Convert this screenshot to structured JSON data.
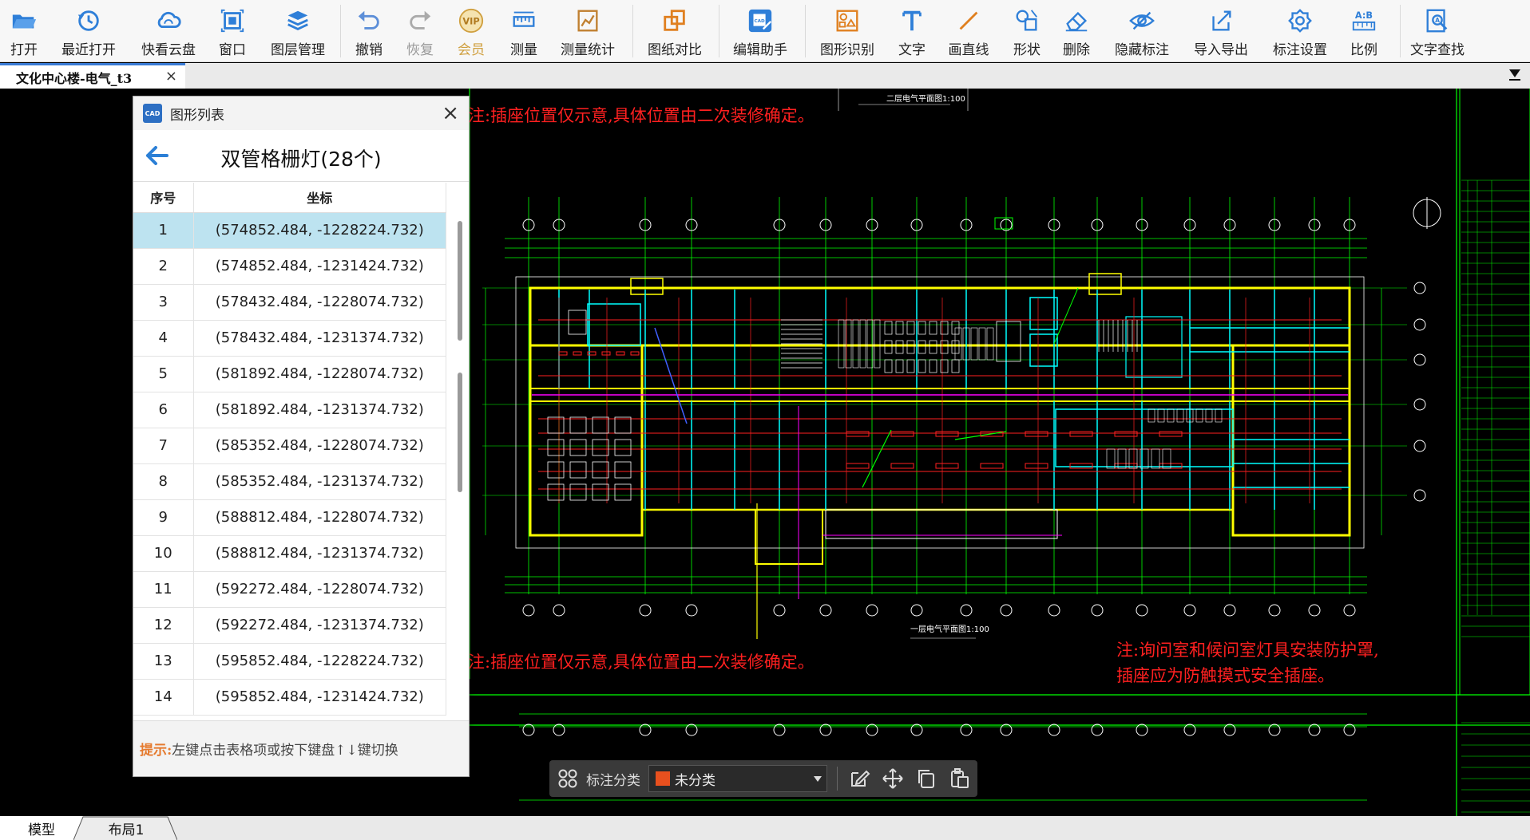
{
  "toolbar": {
    "items": [
      {
        "label": "打开",
        "icon": "folder-open-icon"
      },
      {
        "label": "最近打开",
        "icon": "history-icon"
      },
      {
        "label": "快看云盘",
        "icon": "cloud-icon"
      },
      {
        "label": "窗口",
        "icon": "window-icon"
      },
      {
        "label": "图层管理",
        "icon": "layers-icon"
      },
      {
        "label": "撤销",
        "icon": "undo-icon"
      },
      {
        "label": "恢复",
        "icon": "redo-icon"
      },
      {
        "label": "会员",
        "icon": "vip-icon"
      },
      {
        "label": "测量",
        "icon": "ruler-icon"
      },
      {
        "label": "测量统计",
        "icon": "measure-stats-icon"
      },
      {
        "label": "图纸对比",
        "icon": "compare-icon"
      },
      {
        "label": "编辑助手",
        "icon": "cad-edit-icon"
      },
      {
        "label": "图形识别",
        "icon": "shape-recognize-icon"
      },
      {
        "label": "文字",
        "icon": "text-icon"
      },
      {
        "label": "画直线",
        "icon": "line-icon"
      },
      {
        "label": "形状",
        "icon": "shapes-icon"
      },
      {
        "label": "删除",
        "icon": "eraser-icon"
      },
      {
        "label": "隐藏标注",
        "icon": "eye-hide-icon"
      },
      {
        "label": "导入导出",
        "icon": "import-export-icon"
      },
      {
        "label": "标注设置",
        "icon": "annotation-settings-icon"
      },
      {
        "label": "比例",
        "icon": "scale-icon"
      },
      {
        "label": "文字查找",
        "icon": "text-search-icon"
      }
    ],
    "vip_icon_text": "VIP",
    "scale_icon_text": "A:B",
    "cad_icon_text": "CAD"
  },
  "tab": {
    "title": "文化中心楼-电气_t3",
    "close": "×"
  },
  "panel": {
    "title": "图形列表",
    "logo_text": "CAD",
    "close": "×",
    "group_title": "双管格栅灯(28个)",
    "columns": [
      "序号",
      "坐标"
    ],
    "selected_index": 0,
    "rows": [
      {
        "index": "1",
        "coord": "(574852.484, -1228224.732)"
      },
      {
        "index": "2",
        "coord": "(574852.484, -1231424.732)"
      },
      {
        "index": "3",
        "coord": "(578432.484, -1228074.732)"
      },
      {
        "index": "4",
        "coord": "(578432.484, -1231374.732)"
      },
      {
        "index": "5",
        "coord": "(581892.484, -1228074.732)"
      },
      {
        "index": "6",
        "coord": "(581892.484, -1231374.732)"
      },
      {
        "index": "7",
        "coord": "(585352.484, -1228074.732)"
      },
      {
        "index": "8",
        "coord": "(585352.484, -1231374.732)"
      },
      {
        "index": "9",
        "coord": "(588812.484, -1228074.732)"
      },
      {
        "index": "10",
        "coord": "(588812.484, -1231374.732)"
      },
      {
        "index": "11",
        "coord": "(592272.484, -1228074.732)"
      },
      {
        "index": "12",
        "coord": "(592272.484, -1231374.732)"
      },
      {
        "index": "13",
        "coord": "(595852.484, -1228224.732)"
      },
      {
        "index": "14",
        "coord": "(595852.484, -1231424.732)"
      }
    ],
    "hint_label": "提示:",
    "hint_text": "左键点击表格项或按下键盘↑↓键切换"
  },
  "drawing": {
    "note_top": "注:插座位置仅示意,具体位置由二次装修确定。",
    "note_bottom": "注:插座位置仅示意,具体位置由二次装修确定。",
    "note_right_1": "注:询问室和候问室灯具安装防护罩,",
    "note_right_2": "插座应为防触摸式安全插座。",
    "plan_title_top": "二层电气平面图1:100",
    "plan_title_bottom": "一层电气平面图1:100",
    "colors": {
      "wall": "#ffff00",
      "grid": "#00ff00",
      "room": "#00ffff",
      "wire": "#ff2020",
      "furniture": "#ffffff",
      "magenta": "#ff00ff",
      "blue": "#4060ff"
    }
  },
  "annotation_bar": {
    "label": "标注分类",
    "value": "未分类",
    "swatch_color": "#e8501e"
  },
  "bottom_tabs": {
    "model": "模型",
    "layout1": "布局1"
  }
}
